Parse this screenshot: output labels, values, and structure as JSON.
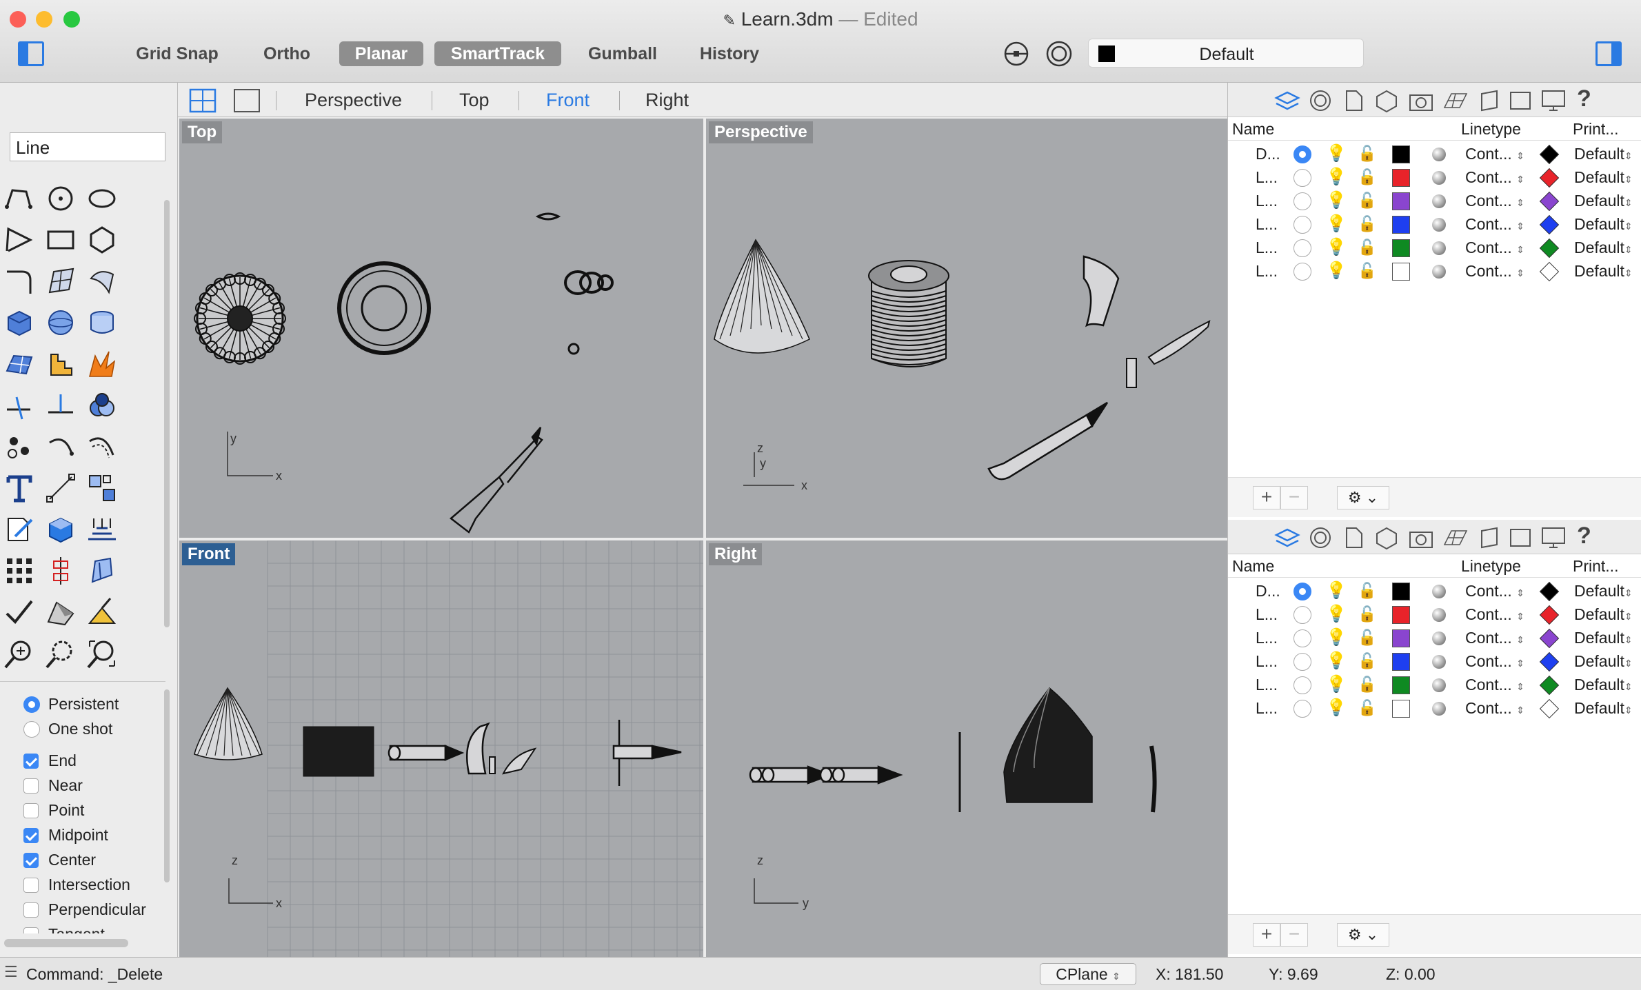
{
  "window": {
    "title": "Learn.3dm",
    "separator": " — ",
    "edited": "Edited"
  },
  "toolbar": {
    "buttons": [
      {
        "label": "Grid Snap",
        "active": false
      },
      {
        "label": "Ortho",
        "active": false
      },
      {
        "label": "Planar",
        "active": true
      },
      {
        "label": "SmartTrack",
        "active": true
      },
      {
        "label": "Gumball",
        "active": false
      },
      {
        "label": "History",
        "active": false
      }
    ],
    "current_layer": "Default"
  },
  "command_input": "Line",
  "viewport_tabs": [
    "Perspective",
    "Top",
    "Front",
    "Right"
  ],
  "active_viewport_tab": "Front",
  "viewports": {
    "top": "Top",
    "perspective": "Perspective",
    "front": "Front",
    "right": "Right"
  },
  "axes": {
    "top": [
      "y",
      "x"
    ],
    "perspective": [
      "z",
      "y",
      "x"
    ],
    "front": [
      "z",
      "x"
    ],
    "right": [
      "z",
      "y"
    ]
  },
  "snap_mode": [
    {
      "label": "Persistent",
      "selected": true
    },
    {
      "label": "One shot",
      "selected": false
    }
  ],
  "osnaps": [
    {
      "label": "End",
      "checked": true
    },
    {
      "label": "Near",
      "checked": false
    },
    {
      "label": "Point",
      "checked": false
    },
    {
      "label": "Midpoint",
      "checked": true
    },
    {
      "label": "Center",
      "checked": true
    },
    {
      "label": "Intersection",
      "checked": false
    },
    {
      "label": "Perpendicular",
      "checked": false
    },
    {
      "label": "Tangent",
      "checked": false
    }
  ],
  "layers_panel": {
    "columns": {
      "name": "Name",
      "linetype": "Linetype",
      "print": "Print..."
    },
    "rows": [
      {
        "name": "D...",
        "current": true,
        "color": "#000000",
        "linetype": "Cont...",
        "print": "Default"
      },
      {
        "name": "L...",
        "current": false,
        "color": "#e8232a",
        "linetype": "Cont...",
        "print": "Default"
      },
      {
        "name": "L...",
        "current": false,
        "color": "#8a45cf",
        "linetype": "Cont...",
        "print": "Default"
      },
      {
        "name": "L...",
        "current": false,
        "color": "#1e3ff0",
        "linetype": "Cont...",
        "print": "Default"
      },
      {
        "name": "L...",
        "current": false,
        "color": "#0f8a22",
        "linetype": "Cont...",
        "print": "Default"
      },
      {
        "name": "L...",
        "current": false,
        "color": "#ffffff",
        "linetype": "Cont...",
        "print": "Default"
      }
    ],
    "add": "+",
    "remove": "−"
  },
  "status": {
    "command": "Command: _Delete",
    "cplane": "CPlane",
    "x": "X: 181.50",
    "y": "Y: 9.69",
    "z": "Z: 0.00"
  }
}
